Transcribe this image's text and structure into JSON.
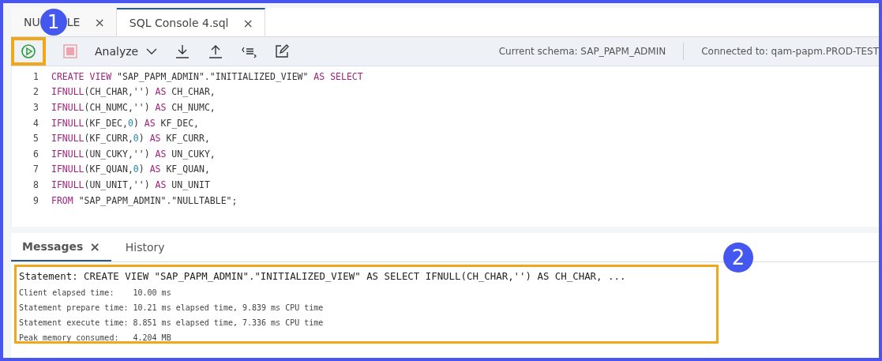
{
  "editor_tabs": [
    {
      "label_parts": [
        "NU",
        "LE"
      ],
      "close": "×",
      "selected": false
    },
    {
      "label": "SQL Console 4.sql",
      "close": "×",
      "selected": true
    }
  ],
  "callouts": [
    "1",
    "2"
  ],
  "toolbar": {
    "analyze": "Analyze",
    "schema": "Current schema: SAP_PAPM_ADMIN",
    "connection": "Connected to: qam-papm.PROD-TEST"
  },
  "code_lines": [
    {
      "number": "1",
      "tokens": [
        {
          "t": "CREATE VIEW",
          "kind": "keyword"
        },
        {
          "t": " \"SAP_PAPM_ADMIN\".\"INITIALIZED_VIEW\" ",
          "kind": "plain"
        },
        {
          "t": "AS SELECT",
          "kind": "keyword"
        }
      ]
    },
    {
      "number": "2",
      "tokens": [
        {
          "t": "IFNULL",
          "kind": "keyword"
        },
        {
          "t": "(CH_CHAR,'') ",
          "kind": "plain"
        },
        {
          "t": "AS",
          "kind": "keyword"
        },
        {
          "t": " CH_CHAR,",
          "kind": "plain"
        }
      ]
    },
    {
      "number": "3",
      "tokens": [
        {
          "t": "IFNULL",
          "kind": "keyword"
        },
        {
          "t": "(CH_NUMC,'') ",
          "kind": "plain"
        },
        {
          "t": "AS",
          "kind": "keyword"
        },
        {
          "t": " CH_NUMC,",
          "kind": "plain"
        }
      ]
    },
    {
      "number": "4",
      "tokens": [
        {
          "t": "IFNULL",
          "kind": "keyword"
        },
        {
          "t": "(KF_DEC,",
          "kind": "plain"
        },
        {
          "t": "0",
          "kind": "number"
        },
        {
          "t": ") ",
          "kind": "plain"
        },
        {
          "t": "AS",
          "kind": "keyword"
        },
        {
          "t": " KF_DEC,",
          "kind": "plain"
        }
      ]
    },
    {
      "number": "5",
      "tokens": [
        {
          "t": "IFNULL",
          "kind": "keyword"
        },
        {
          "t": "(KF_CURR,",
          "kind": "plain"
        },
        {
          "t": "0",
          "kind": "number"
        },
        {
          "t": ") ",
          "kind": "plain"
        },
        {
          "t": "AS",
          "kind": "keyword"
        },
        {
          "t": " KF_CURR,",
          "kind": "plain"
        }
      ]
    },
    {
      "number": "6",
      "tokens": [
        {
          "t": "IFNULL",
          "kind": "keyword"
        },
        {
          "t": "(UN_CUKY,'') ",
          "kind": "plain"
        },
        {
          "t": "AS",
          "kind": "keyword"
        },
        {
          "t": " UN_CUKY,",
          "kind": "plain"
        }
      ]
    },
    {
      "number": "7",
      "tokens": [
        {
          "t": "IFNULL",
          "kind": "keyword"
        },
        {
          "t": "(KF_QUAN,",
          "kind": "plain"
        },
        {
          "t": "0",
          "kind": "number"
        },
        {
          "t": ") ",
          "kind": "plain"
        },
        {
          "t": "AS",
          "kind": "keyword"
        },
        {
          "t": " KF_QUAN,",
          "kind": "plain"
        }
      ]
    },
    {
      "number": "8",
      "tokens": [
        {
          "t": "IFNULL",
          "kind": "keyword"
        },
        {
          "t": "(UN_UNIT,'') ",
          "kind": "plain"
        },
        {
          "t": "AS",
          "kind": "keyword"
        },
        {
          "t": " UN_UNIT",
          "kind": "plain"
        }
      ]
    },
    {
      "number": "9",
      "tokens": [
        {
          "t": "FROM",
          "kind": "keyword"
        },
        {
          "t": " \"SAP_PAPM_ADMIN\".\"NULLTABLE\";",
          "kind": "plain"
        }
      ]
    }
  ],
  "result_tabs": [
    {
      "label": "Messages",
      "close": "×",
      "selected": true
    },
    {
      "label": "History",
      "selected": false
    }
  ],
  "messages": {
    "statement": "Statement: CREATE VIEW \"SAP_PAPM_ADMIN\".\"INITIALIZED_VIEW\" AS SELECT IFNULL(CH_CHAR,'') AS CH_CHAR, ...",
    "lines": [
      "Client elapsed time:    10.00 ms",
      "Statement prepare time: 10.21 ms elapsed time, 9.839 ms CPU time",
      "Statement execute time: 8.851 ms elapsed time, 7.336 ms CPU time",
      "Peak memory consumed:   4.204 MB"
    ]
  }
}
